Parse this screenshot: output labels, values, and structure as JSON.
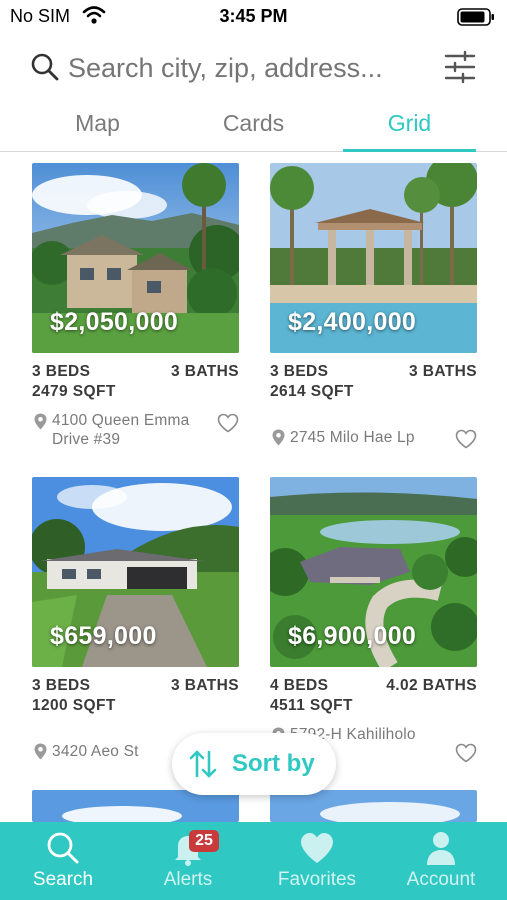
{
  "status_bar": {
    "carrier": "No SIM",
    "time": "3:45 PM"
  },
  "search": {
    "placeholder": "Search city, zip, address..."
  },
  "tabs": [
    {
      "label": "Map",
      "active": false
    },
    {
      "label": "Cards",
      "active": false
    },
    {
      "label": "Grid",
      "active": true
    }
  ],
  "listings": [
    {
      "price": "$2,050,000",
      "beds": "3 BEDS",
      "baths": "3 BATHS",
      "sqft": "2479 SQFT",
      "address": "4100 Queen Emma Drive #39",
      "favorite": false
    },
    {
      "price": "$2,400,000",
      "beds": "3 BEDS",
      "baths": "3 BATHS",
      "sqft": "2614 SQFT",
      "address": "2745 Milo Hae Lp",
      "favorite": false
    },
    {
      "price": "$659,000",
      "beds": "3 BEDS",
      "baths": "3 BATHS",
      "sqft": "1200 SQFT",
      "address": "3420 Aeo St",
      "favorite": false
    },
    {
      "price": "$6,900,000",
      "beds": "4 BEDS",
      "baths": "4.02 BATHS",
      "sqft": "4511 SQFT",
      "address": "5792-H Kahiliholo",
      "favorite": false
    }
  ],
  "sort_button": {
    "label": "Sort by"
  },
  "bottom_nav": {
    "items": [
      {
        "label": "Search",
        "icon": "search-icon",
        "active": true
      },
      {
        "label": "Alerts",
        "icon": "bell-icon",
        "active": false,
        "badge": "25"
      },
      {
        "label": "Favorites",
        "icon": "heart-icon",
        "active": false
      },
      {
        "label": "Account",
        "icon": "person-icon",
        "active": false
      }
    ]
  },
  "colors": {
    "accent": "#2fc8c2",
    "badge": "#c93b3b",
    "text": "#3a3a3a",
    "muted": "#7a7a7a"
  }
}
